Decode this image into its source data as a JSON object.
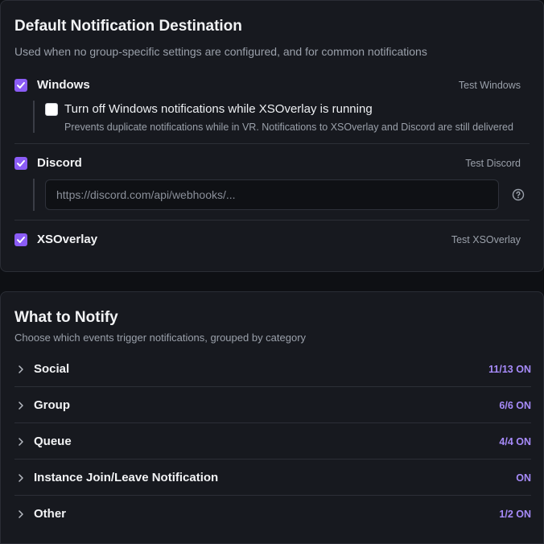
{
  "destination": {
    "title": "Default Notification Destination",
    "subtitle": "Used when no group-specific settings are configured, and for common notifications",
    "windows": {
      "label": "Windows",
      "checked": true,
      "test_label": "Test Windows",
      "sub_option": {
        "label": "Turn off Windows notifications while XSOverlay is running",
        "description": "Prevents duplicate notifications while in VR. Notifications to XSOverlay and Discord are still delivered",
        "checked": false
      }
    },
    "discord": {
      "label": "Discord",
      "checked": true,
      "test_label": "Test Discord",
      "webhook_placeholder": "https://discord.com/api/webhooks/...",
      "webhook_value": ""
    },
    "xsoverlay": {
      "label": "XSOverlay",
      "checked": true,
      "test_label": "Test XSOverlay"
    }
  },
  "notify": {
    "title": "What to Notify",
    "subtitle": "Choose which events trigger notifications, grouped by category",
    "categories": [
      {
        "name": "Social",
        "count": "11/13 ON"
      },
      {
        "name": "Group",
        "count": "6/6 ON"
      },
      {
        "name": "Queue",
        "count": "4/4 ON"
      },
      {
        "name": "Instance Join/Leave Notification",
        "count": "ON"
      },
      {
        "name": "Other",
        "count": "1/2 ON"
      }
    ]
  },
  "colors": {
    "accent": "#8b5cf6",
    "count_text": "#a78bfa",
    "card_bg": "#17191f",
    "page_bg": "#0e1014"
  },
  "icons": {
    "checkbox_checked": "check-icon",
    "help": "help-circle-icon",
    "expand": "chevron-right-icon"
  }
}
